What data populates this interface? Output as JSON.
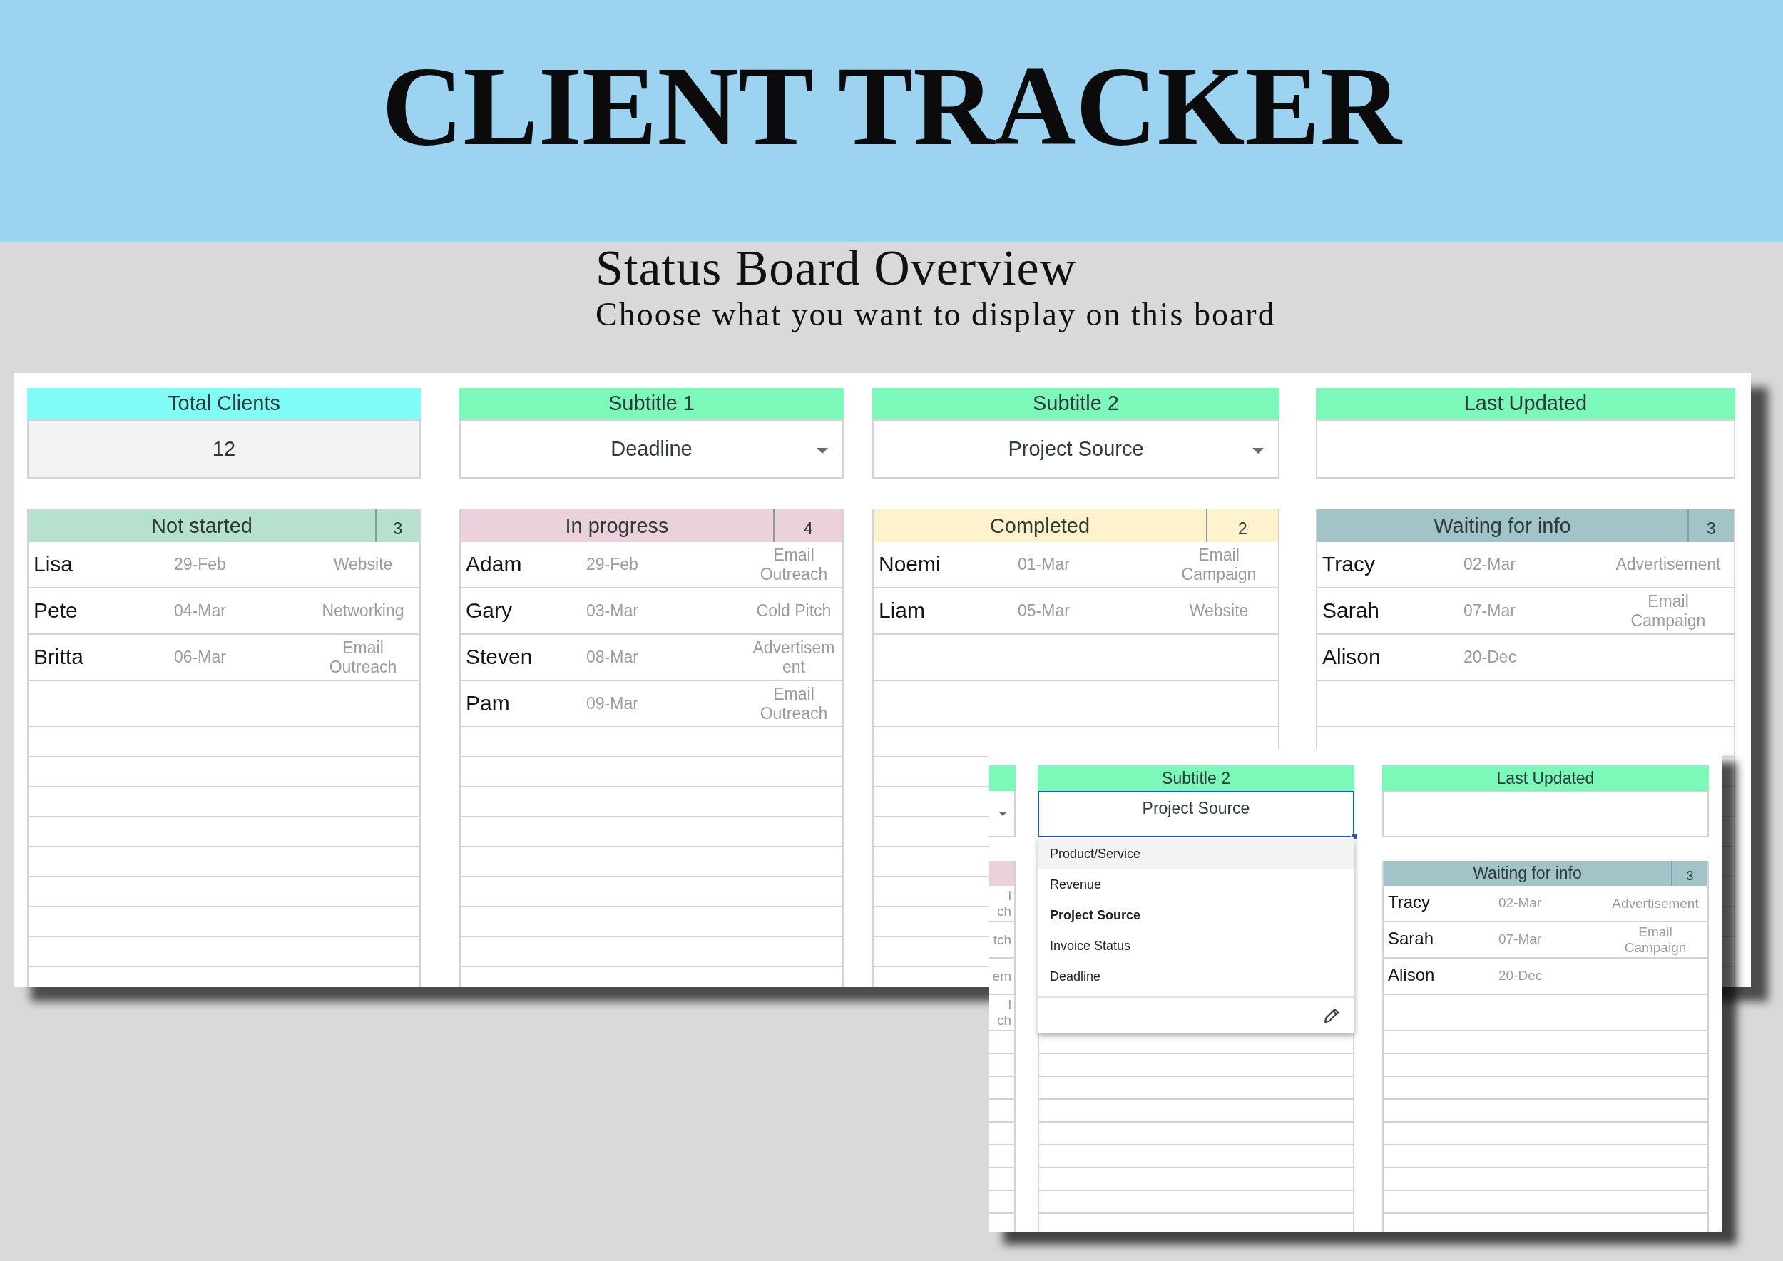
{
  "banner": {
    "title": "CLIENT TRACKER"
  },
  "intro": {
    "heading": "Status Board Overview",
    "subheading": "Choose what you want to display on this board"
  },
  "board": {
    "cards": [
      {
        "kind": "stat",
        "label": "Total Clients",
        "value": "12"
      },
      {
        "kind": "dropdown",
        "label": "Subtitle 1",
        "value": "Deadline"
      },
      {
        "kind": "dropdown",
        "label": "Subtitle 2",
        "value": "Project Source"
      },
      {
        "kind": "date",
        "label": "Last Updated"
      }
    ],
    "columns": [
      {
        "title": "Not started",
        "count": "3",
        "color": "#b6e1cd",
        "rows": [
          {
            "name": "Lisa",
            "date": "29-Feb",
            "source": "Website"
          },
          {
            "name": "Pete",
            "date": "04-Mar",
            "source": "Networking"
          },
          {
            "name": "Britta",
            "date": "06-Mar",
            "source": "Email Outreach"
          }
        ]
      },
      {
        "title": "In progress",
        "count": "4",
        "color": "#ead1dc",
        "rows": [
          {
            "name": "Adam",
            "date": "29-Feb",
            "source": "Email Outreach"
          },
          {
            "name": "Gary",
            "date": "03-Mar",
            "source": "Cold Pitch"
          },
          {
            "name": "Steven",
            "date": "08-Mar",
            "source": "Advertisement"
          },
          {
            "name": "Pam",
            "date": "09-Mar",
            "source": "Email Outreach"
          }
        ]
      },
      {
        "title": "Completed",
        "count": "2",
        "color": "#fff2cc",
        "rows": [
          {
            "name": "Noemi",
            "date": "01-Mar",
            "source": "Email Campaign"
          },
          {
            "name": "Liam",
            "date": "05-Mar",
            "source": "Website"
          }
        ]
      },
      {
        "title": "Waiting for info",
        "count": "3",
        "color": "#a2c4c9",
        "rows": [
          {
            "name": "Tracy",
            "date": "02-Mar",
            "source": "Advertisement"
          },
          {
            "name": "Sarah",
            "date": "07-Mar",
            "source": "Email Campaign"
          },
          {
            "name": "Alison",
            "date": "20-Dec"
          }
        ]
      }
    ]
  },
  "zoom_view": {
    "edge_column": {
      "color": "#ead1dc",
      "cells": [
        {
          "lines": [
            "l",
            "ch"
          ]
        },
        {
          "lines": [
            "tch"
          ]
        },
        {
          "lines": [
            "em"
          ]
        },
        {
          "lines": [
            "l",
            "ch"
          ]
        }
      ]
    },
    "cards": [
      {
        "kind": "dropdown",
        "label": "Subtitle 2",
        "value": "Project Source",
        "focused": true
      },
      {
        "kind": "date",
        "label": "Last Updated"
      }
    ],
    "menu": {
      "options": [
        {
          "label": "Product/Service",
          "highlighted": true,
          "selected": false
        },
        {
          "label": "Revenue",
          "highlighted": false,
          "selected": false
        },
        {
          "label": "Project Source",
          "highlighted": false,
          "selected": true
        },
        {
          "label": "Invoice Status",
          "highlighted": false,
          "selected": false
        },
        {
          "label": "Deadline",
          "highlighted": false,
          "selected": false
        }
      ]
    },
    "column": {
      "title": "Waiting for info",
      "count": "3",
      "color": "#a2c4c9",
      "rows": [
        {
          "name": "Tracy",
          "date": "02-Mar",
          "source": "Advertisement"
        },
        {
          "name": "Sarah",
          "date": "07-Mar",
          "source": "Email Campaign"
        },
        {
          "name": "Alison",
          "date": "20-Dec"
        }
      ]
    }
  }
}
